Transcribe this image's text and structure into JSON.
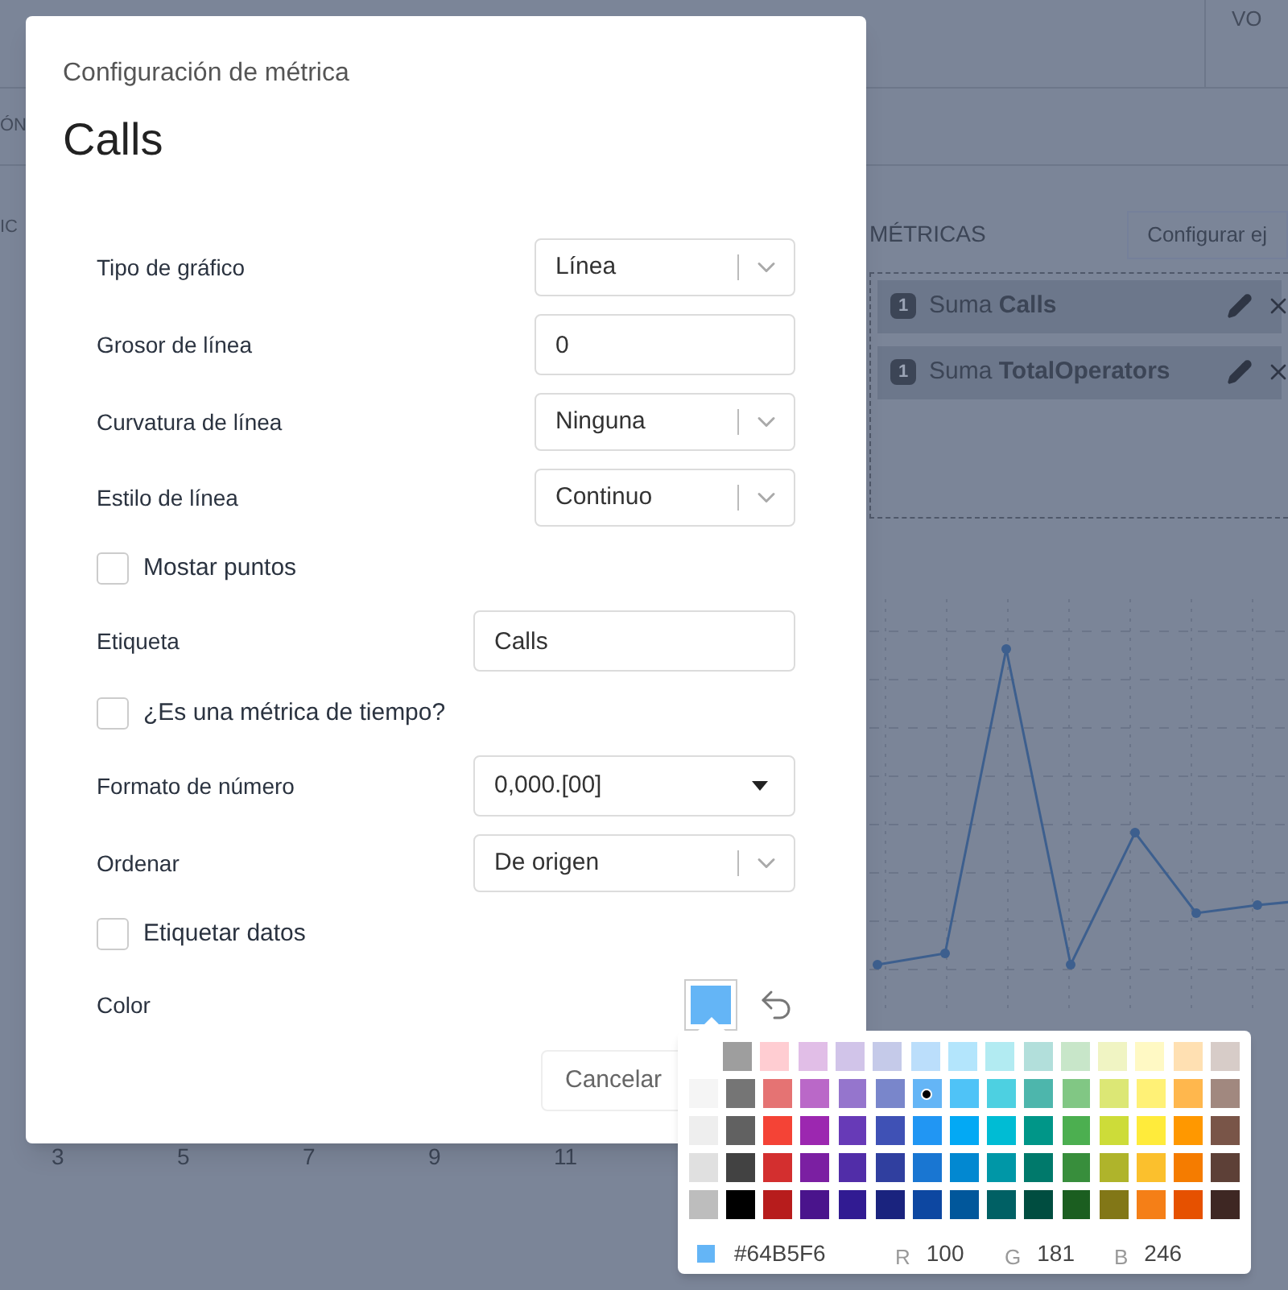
{
  "background": {
    "top_right_text": "VO",
    "left_texts": [
      "ÓN",
      "IC"
    ],
    "metrics_panel": {
      "title": "MÉTRICAS",
      "configure_button": "Configurar ej",
      "metrics": [
        {
          "badge": "1",
          "label": "Suma **Calls**"
        },
        {
          "badge": "1",
          "label": "Suma **TotalOperators**"
        }
      ]
    },
    "x_axis_labels": [
      "3",
      "5",
      "7",
      "9",
      "11"
    ]
  },
  "dialog": {
    "subtitle": "Configuración de métrica",
    "title": "Calls",
    "fields": [
      {
        "kind": "select",
        "label": "Tipo de gráfico",
        "value": "Línea"
      },
      {
        "kind": "input",
        "label": "Grosor de línea",
        "value": "0"
      },
      {
        "kind": "select",
        "label": "Curvatura de línea",
        "value": "Ninguna"
      },
      {
        "kind": "select",
        "label": "Estilo de línea",
        "value": "Continuo"
      },
      {
        "kind": "checkbox",
        "label": "Mostar puntos",
        "checked": false
      },
      {
        "kind": "input",
        "label": "Etiqueta",
        "value": "Calls"
      },
      {
        "kind": "checkbox",
        "label": "¿Es una métrica de tiempo?",
        "checked": false
      },
      {
        "kind": "dropdown",
        "label": "Formato de número",
        "value": "0,000.[00]"
      },
      {
        "kind": "select",
        "label": "Ordenar",
        "value": "De origen"
      },
      {
        "kind": "checkbox",
        "label": "Etiquetar datos",
        "checked": false
      },
      {
        "kind": "color",
        "label": "Color",
        "color": "#64b5f6"
      }
    ],
    "buttons": [
      "Cancelar"
    ]
  },
  "color_picker": {
    "rows": [
      {
        "swatches": [
          {
            "color": "#9e9e9e",
            "selected": false
          },
          {
            "color": "#ffcdd2",
            "selected": false
          },
          {
            "color": "#e1bee7",
            "selected": false
          },
          {
            "color": "#d1c4e9",
            "selected": false
          },
          {
            "color": "#c5cae9",
            "selected": false
          },
          {
            "color": "#bbdefb",
            "selected": false
          },
          {
            "color": "#b3e5fc",
            "selected": false
          },
          {
            "color": "#b2ebf2",
            "selected": false
          },
          {
            "color": "#b2dfdb",
            "selected": false
          },
          {
            "color": "#c8e6c9",
            "selected": false
          },
          {
            "color": "#f0f4c3",
            "selected": false
          },
          {
            "color": "#fff9c4",
            "selected": false
          },
          {
            "color": "#ffe0b2",
            "selected": false
          },
          {
            "color": "#d7ccc8",
            "selected": false
          }
        ]
      },
      {
        "swatches": [
          {
            "color": "#f5f5f5",
            "selected": false
          },
          {
            "color": "#757575",
            "selected": false
          },
          {
            "color": "#e57373",
            "selected": false
          },
          {
            "color": "#ba68c8",
            "selected": false
          },
          {
            "color": "#9575cd",
            "selected": false
          },
          {
            "color": "#7986cb",
            "selected": false
          },
          {
            "color": "#64b5f6",
            "selected": true
          },
          {
            "color": "#4fc3f7",
            "selected": false
          },
          {
            "color": "#4dd0e1",
            "selected": false
          },
          {
            "color": "#4db6ac",
            "selected": false
          },
          {
            "color": "#81c784",
            "selected": false
          },
          {
            "color": "#dce775",
            "selected": false
          },
          {
            "color": "#fff176",
            "selected": false
          },
          {
            "color": "#ffb74d",
            "selected": false
          },
          {
            "color": "#a1887f",
            "selected": false
          }
        ]
      },
      {
        "swatches": [
          {
            "color": "#eeeeee",
            "selected": false
          },
          {
            "color": "#616161",
            "selected": false
          },
          {
            "color": "#f44336",
            "selected": false
          },
          {
            "color": "#9c27b0",
            "selected": false
          },
          {
            "color": "#673ab7",
            "selected": false
          },
          {
            "color": "#3f51b5",
            "selected": false
          },
          {
            "color": "#2196f3",
            "selected": false
          },
          {
            "color": "#03a9f4",
            "selected": false
          },
          {
            "color": "#00bcd4",
            "selected": false
          },
          {
            "color": "#009688",
            "selected": false
          },
          {
            "color": "#4caf50",
            "selected": false
          },
          {
            "color": "#cddc39",
            "selected": false
          },
          {
            "color": "#ffeb3b",
            "selected": false
          },
          {
            "color": "#ff9800",
            "selected": false
          },
          {
            "color": "#795548",
            "selected": false
          }
        ]
      },
      {
        "swatches": [
          {
            "color": "#e0e0e0",
            "selected": false
          },
          {
            "color": "#424242",
            "selected": false
          },
          {
            "color": "#d32f2f",
            "selected": false
          },
          {
            "color": "#7b1fa2",
            "selected": false
          },
          {
            "color": "#512da8",
            "selected": false
          },
          {
            "color": "#303f9f",
            "selected": false
          },
          {
            "color": "#1976d2",
            "selected": false
          },
          {
            "color": "#0288d1",
            "selected": false
          },
          {
            "color": "#0097a7",
            "selected": false
          },
          {
            "color": "#00796b",
            "selected": false
          },
          {
            "color": "#388e3c",
            "selected": false
          },
          {
            "color": "#afb42b",
            "selected": false
          },
          {
            "color": "#fbc02d",
            "selected": false
          },
          {
            "color": "#f57c00",
            "selected": false
          },
          {
            "color": "#5d4037",
            "selected": false
          }
        ]
      },
      {
        "swatches": [
          {
            "color": "#bdbdbd",
            "selected": false
          },
          {
            "color": "#000000",
            "selected": false
          },
          {
            "color": "#b71c1c",
            "selected": false
          },
          {
            "color": "#4a148c",
            "selected": false
          },
          {
            "color": "#311b92",
            "selected": false
          },
          {
            "color": "#1a237e",
            "selected": false
          },
          {
            "color": "#0d47a1",
            "selected": false
          },
          {
            "color": "#01579b",
            "selected": false
          },
          {
            "color": "#006064",
            "selected": false
          },
          {
            "color": "#004d40",
            "selected": false
          },
          {
            "color": "#1b5e20",
            "selected": false
          },
          {
            "color": "#827717",
            "selected": false
          },
          {
            "color": "#f57f17",
            "selected": false
          },
          {
            "color": "#e65100",
            "selected": false
          },
          {
            "color": "#3e2723",
            "selected": false
          }
        ]
      }
    ],
    "hex": "#64B5F6",
    "channels": [
      {
        "label": "R",
        "value": "100"
      },
      {
        "label": "G",
        "value": "181"
      },
      {
        "label": "B",
        "value": "246"
      }
    ]
  }
}
